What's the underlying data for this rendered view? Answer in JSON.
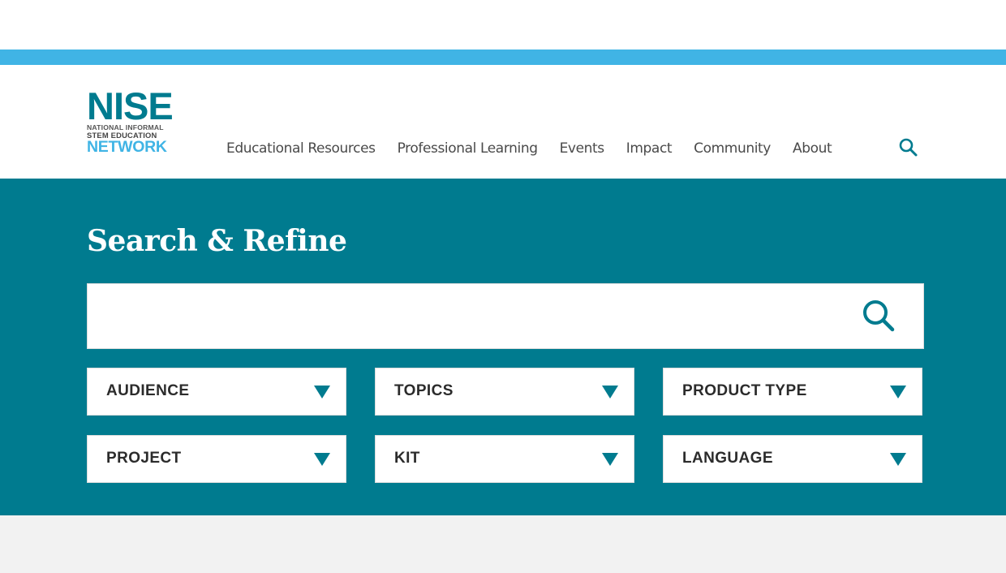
{
  "logo": {
    "main": "NISE",
    "line1": "NATIONAL INFORMAL",
    "line2": "STEM EDUCATION",
    "line3": "NETWORK"
  },
  "nav": {
    "items": [
      {
        "label": "Educational Resources"
      },
      {
        "label": "Professional Learning"
      },
      {
        "label": "Events"
      },
      {
        "label": "Impact"
      },
      {
        "label": "Community"
      },
      {
        "label": "About"
      }
    ],
    "search_icon": "search-icon"
  },
  "search": {
    "title": "Search & Refine",
    "value": "",
    "placeholder": "",
    "submit_icon": "search-icon"
  },
  "filters": [
    {
      "label": "AUDIENCE"
    },
    {
      "label": "TOPICS"
    },
    {
      "label": "PRODUCT TYPE"
    },
    {
      "label": "PROJECT"
    },
    {
      "label": "KIT"
    },
    {
      "label": "LANGUAGE"
    }
  ],
  "colors": {
    "brand_teal": "#007b8f",
    "accent_blue": "#40b4e5",
    "footer_gray": "#f2f2f2"
  }
}
